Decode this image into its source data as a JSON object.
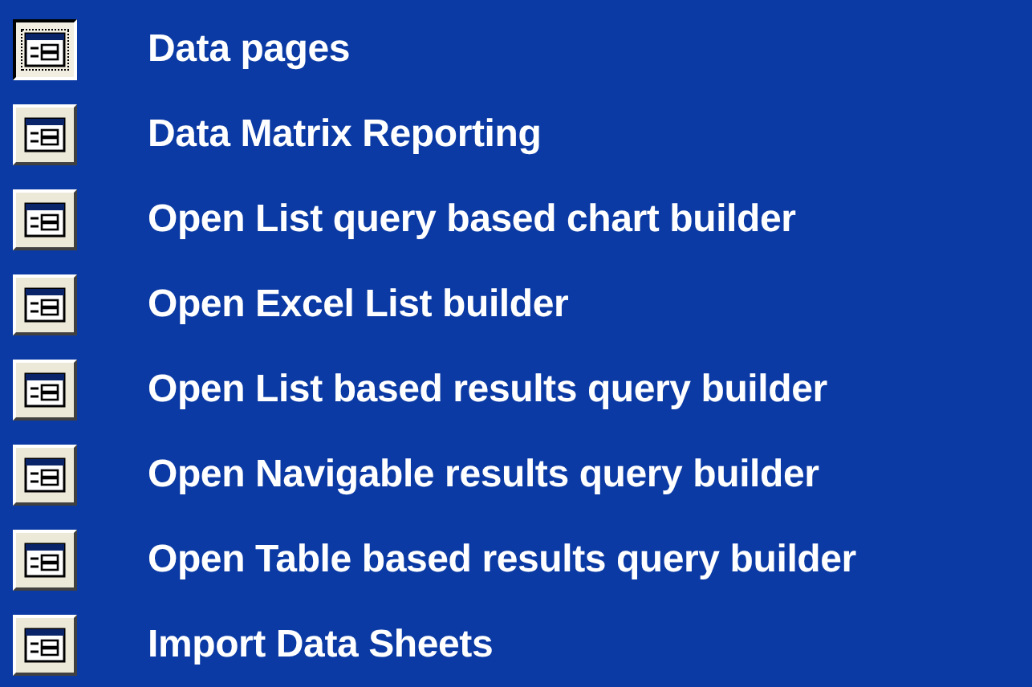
{
  "items": [
    {
      "label": "Data pages",
      "selected": true
    },
    {
      "label": "Data Matrix Reporting",
      "selected": false
    },
    {
      "label": "Open List query based chart builder",
      "selected": false
    },
    {
      "label": "Open Excel List builder",
      "selected": false
    },
    {
      "label": "Open List based results query builder",
      "selected": false
    },
    {
      "label": "Open Navigable results query builder",
      "selected": false
    },
    {
      "label": "Open Table based results query builder",
      "selected": false
    },
    {
      "label": "Import Data Sheets",
      "selected": false
    }
  ]
}
